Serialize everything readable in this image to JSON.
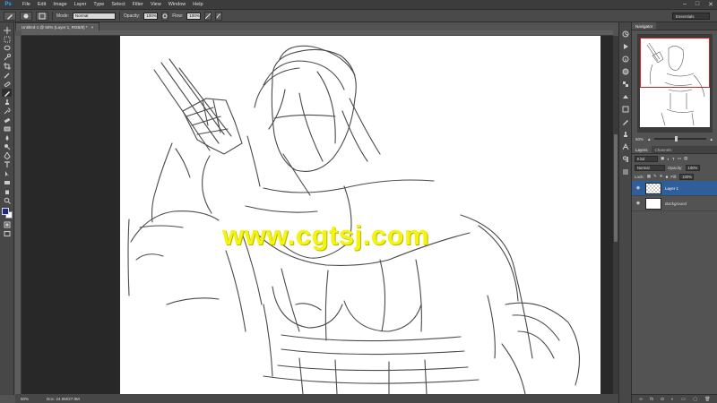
{
  "menubar": {
    "logo": "Ps",
    "items": [
      "File",
      "Edit",
      "Image",
      "Layer",
      "Type",
      "Select",
      "Filter",
      "View",
      "Window",
      "Help"
    ],
    "controls": [
      "–",
      "□",
      "✕"
    ]
  },
  "options": {
    "mode_label": "Mode:",
    "mode_value": "Normal",
    "opacity_label": "Opacity:",
    "opacity_value": "100%",
    "flow_label": "Flow:",
    "flow_value": "100%",
    "workspace": "Essentials"
  },
  "document": {
    "tab_title": "Untitled-1 @ 50% (Layer 1, RGB/8) *",
    "tab_close": "×",
    "zoom": "50%",
    "doc_info": "Doc: 24.0M/27.9M",
    "watermark": "www.cgtsj.com"
  },
  "navigator": {
    "tab": "Navigator",
    "zoom": "50%"
  },
  "layers": {
    "tabs": [
      "Layers",
      "Channels"
    ],
    "kind": "Kind",
    "blend": "Normal",
    "opacity_label": "Opacity:",
    "opacity_value": "100%",
    "lock_label": "Lock:",
    "fill_label": "Fill:",
    "fill_value": "100%",
    "items": [
      {
        "name": "Layer 1",
        "selected": true
      },
      {
        "name": "Background",
        "selected": false
      }
    ]
  },
  "colors": {
    "foreground": "#1e2a8a",
    "background": "#ffffff",
    "watermark": "#f4f412"
  }
}
